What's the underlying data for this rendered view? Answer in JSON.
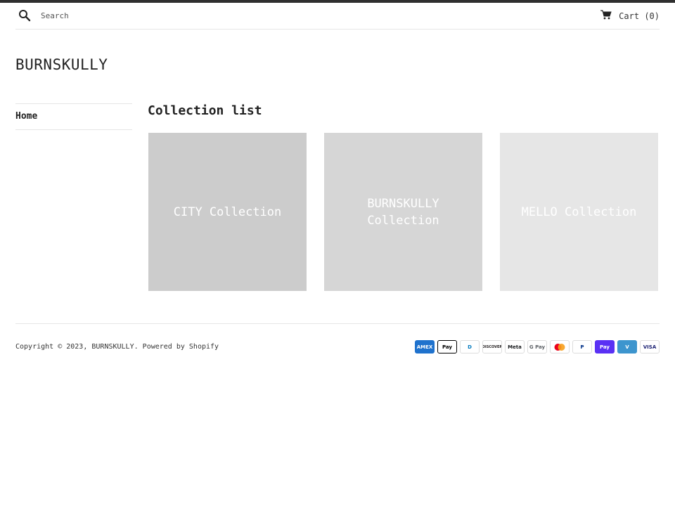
{
  "header": {
    "search_placeholder": "Search",
    "cart_label": "Cart",
    "cart_count": "(0)"
  },
  "site": {
    "logo": "BURNSKULLY"
  },
  "sidebar": {
    "items": [
      {
        "label": "Home"
      }
    ]
  },
  "main": {
    "title": "Collection list",
    "collections": [
      {
        "label": "CITY Collection",
        "color": "#cccccc"
      },
      {
        "label": "BURNSKULLY Collection",
        "color": "#d6d6d6"
      },
      {
        "label": "MELLO Collection",
        "color": "#e6e6e6"
      }
    ]
  },
  "footer": {
    "copyright_prefix": "Copyright © 2023,",
    "copyright_brand": "BURNSKULLY",
    "copyright_sep": ".",
    "powered_by": "Powered by Shopify",
    "payments": [
      {
        "name": "amex-icon",
        "label": "AMEX",
        "bg": "#1f72cd",
        "fg": "#ffffff"
      },
      {
        "name": "apple-pay-icon",
        "label": "Pay",
        "bg": "#ffffff",
        "fg": "#000000"
      },
      {
        "name": "diners-club-icon",
        "label": "D",
        "bg": "#ffffff",
        "fg": "#0079be"
      },
      {
        "name": "discover-icon",
        "label": "DISCOVER",
        "bg": "#ffffff",
        "fg": "#231f20"
      },
      {
        "name": "meta-pay-icon",
        "label": "Meta",
        "bg": "#ffffff",
        "fg": "#1c1e21"
      },
      {
        "name": "google-pay-icon",
        "label": "G Pay",
        "bg": "#ffffff",
        "fg": "#5f6368"
      },
      {
        "name": "mastercard-icon",
        "label": "",
        "bg": "#ffffff",
        "fg": "#eb001b"
      },
      {
        "name": "paypal-icon",
        "label": "P",
        "bg": "#ffffff",
        "fg": "#003087"
      },
      {
        "name": "shop-pay-icon",
        "label": "Pay",
        "bg": "#5a31f4",
        "fg": "#ffffff"
      },
      {
        "name": "venmo-icon",
        "label": "V",
        "bg": "#3d95ce",
        "fg": "#ffffff"
      },
      {
        "name": "visa-icon",
        "label": "VISA",
        "bg": "#ffffff",
        "fg": "#1a1f71"
      }
    ]
  }
}
